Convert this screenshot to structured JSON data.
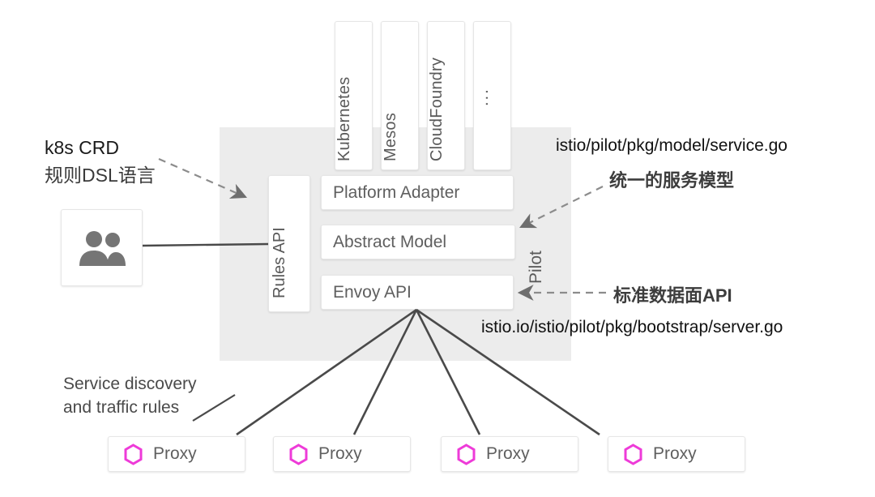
{
  "diagram": {
    "title": "Istio Pilot architecture",
    "colors": {
      "panel_bg": "#ececec",
      "card_bg": "#ffffff",
      "card_border": "#e6e6e6",
      "text_gray": "#5f5f5f",
      "line_gray": "#4a4a4a",
      "dashed_gray": "#9a9a9a",
      "proxy_hex": "#ee3bd8",
      "users_icon": "#757575"
    },
    "panel": {
      "label": "Pilot"
    },
    "platforms": [
      {
        "label": "Kubernetes"
      },
      {
        "label": "Mesos"
      },
      {
        "label": "CloudFoundry"
      },
      {
        "label": "..."
      }
    ],
    "rules_api": {
      "label": "Rules API"
    },
    "stack": [
      {
        "label": "Platform Adapter"
      },
      {
        "label": "Abstract Model"
      },
      {
        "label": "Envoy API"
      }
    ],
    "users_box": {
      "icon": "users-icon"
    },
    "proxies": [
      {
        "label": "Proxy",
        "icon": "hexagon-icon"
      },
      {
        "label": "Proxy",
        "icon": "hexagon-icon"
      },
      {
        "label": "Proxy",
        "icon": "hexagon-icon"
      },
      {
        "label": "Proxy",
        "icon": "hexagon-icon"
      }
    ],
    "annotations": {
      "k8s_crd_line1": "k8s CRD",
      "k8s_crd_line2": "规则DSL语言",
      "service_go_path": "istio/pilot/pkg/model/service.go",
      "unified_service_model": "统一的服务模型",
      "standard_dataplane_api": "标准数据面API",
      "bootstrap_go_path": "istio.io/istio/pilot/pkg/bootstrap/server.go",
      "service_discovery_line1": "Service discovery",
      "service_discovery_line2": "and traffic rules"
    }
  }
}
